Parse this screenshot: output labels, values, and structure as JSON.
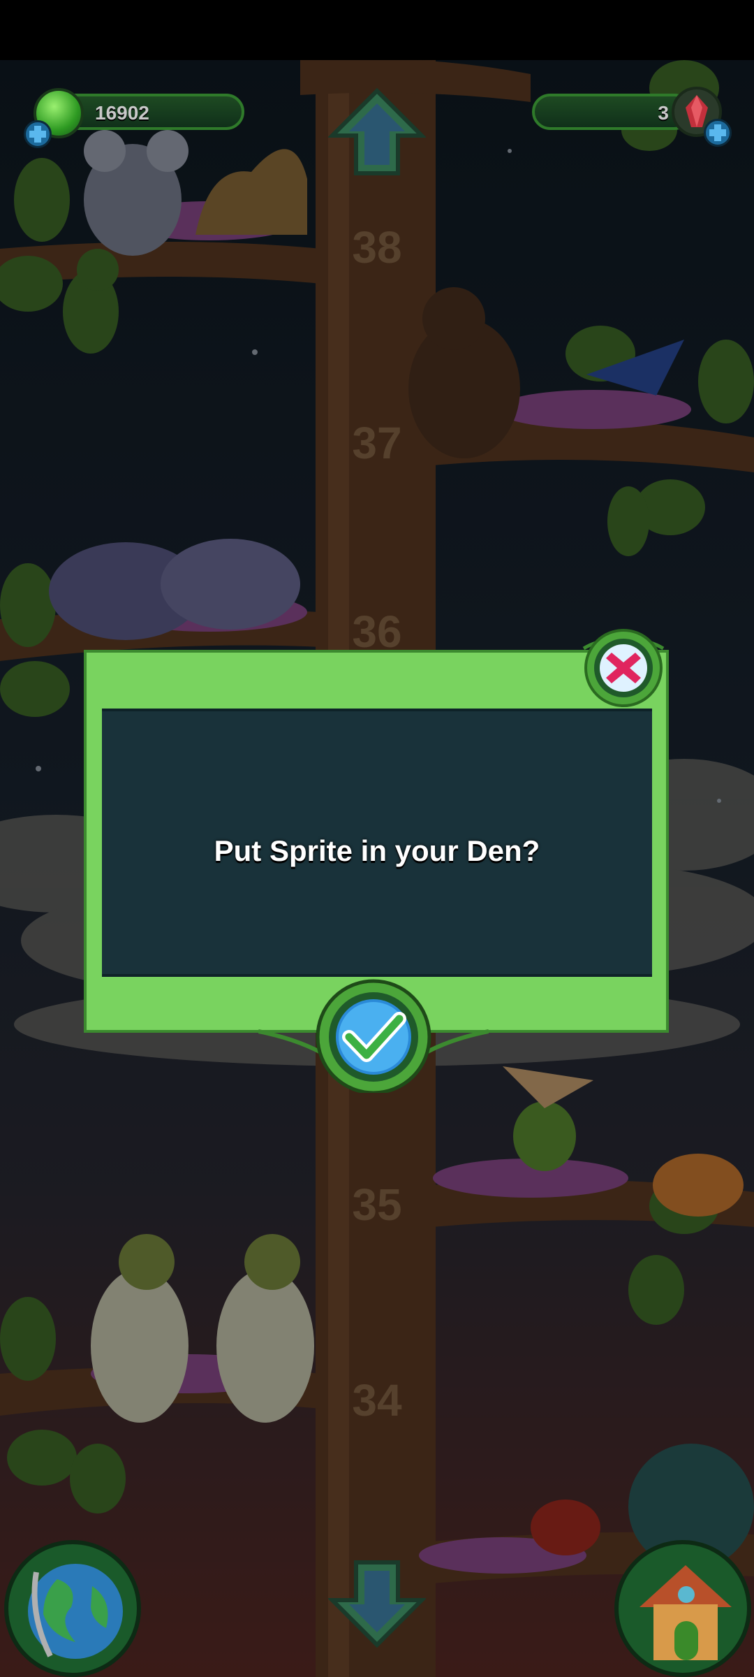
{
  "hud": {
    "coins": "16902",
    "gems": "3"
  },
  "tree": {
    "levels": [
      "38",
      "37",
      "36",
      "35",
      "34"
    ]
  },
  "dialog": {
    "message": "Put Sprite in your Den?"
  },
  "icons": {
    "coin": "green-orb-icon",
    "gem": "red-crystal-icon",
    "add": "plus-icon",
    "up": "up-arrow-icon",
    "down": "down-arrow-icon",
    "close": "close-x-icon",
    "confirm": "checkmark-icon",
    "world": "globe-icon",
    "den": "house-icon"
  },
  "colors": {
    "dialog_frame": "#79d35f",
    "dialog_panel": "#19323a",
    "close": "#e0245e",
    "confirm": "#3cb043"
  }
}
